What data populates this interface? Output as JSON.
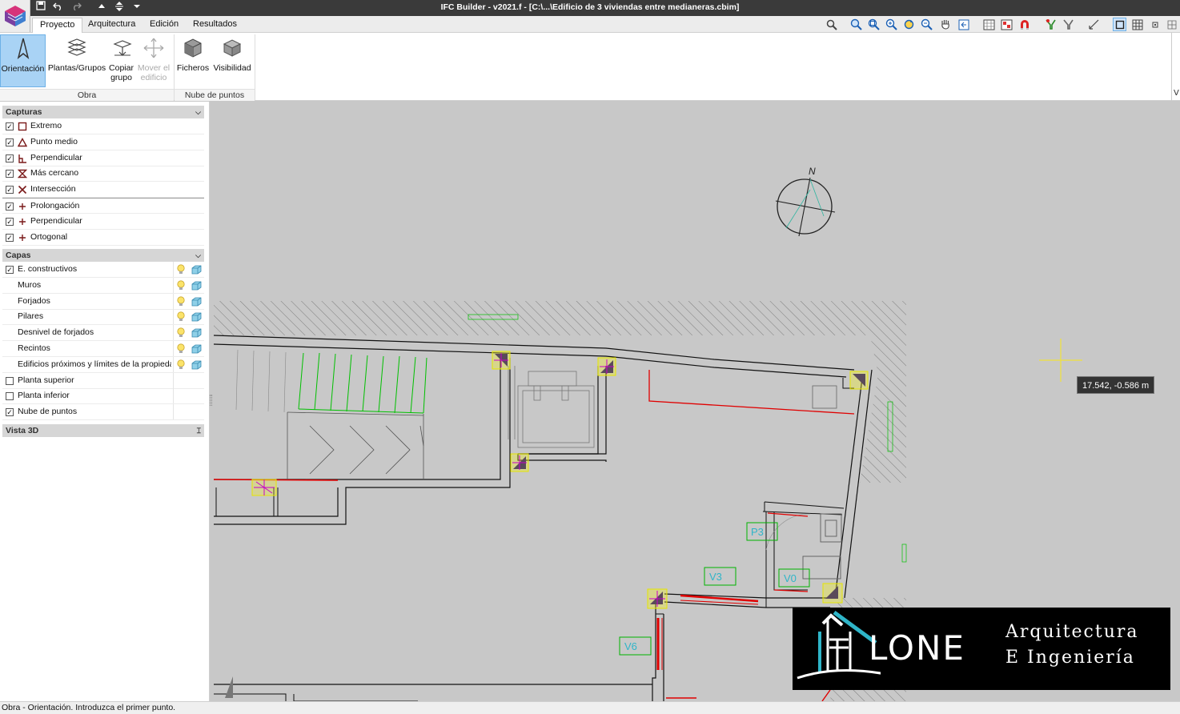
{
  "window": {
    "title": "IFC Builder - v2021.f - [C:\\...\\Edificio de 3 viviendas entre medianeras.cbim]"
  },
  "tabs": [
    {
      "label": "Proyecto",
      "active": true
    },
    {
      "label": "Arquitectura",
      "active": false
    },
    {
      "label": "Edición",
      "active": false
    },
    {
      "label": "Resultados",
      "active": false
    }
  ],
  "ribbon": {
    "buttons": [
      {
        "label": "Orientación",
        "active": true,
        "disabled": false
      },
      {
        "label": "Plantas/Grupos",
        "active": false,
        "disabled": false
      },
      {
        "label": "Copiar grupo",
        "active": false,
        "disabled": false
      },
      {
        "label": "Mover el edificio",
        "active": false,
        "disabled": true
      },
      {
        "label": "Ficheros",
        "active": false,
        "disabled": false
      },
      {
        "label": "Visibilidad",
        "active": false,
        "disabled": false
      }
    ],
    "groups": [
      {
        "label": "Obra"
      },
      {
        "label": "Nube de puntos"
      }
    ],
    "right_edge_label": "V"
  },
  "panel": {
    "capturas": {
      "title": "Capturas",
      "items": [
        {
          "label": "Extremo",
          "checked": true,
          "icon": "square-snap-icon"
        },
        {
          "label": "Punto medio",
          "checked": true,
          "icon": "triangle-snap-icon"
        },
        {
          "label": "Perpendicular",
          "checked": true,
          "icon": "perpendicular-snap-icon"
        },
        {
          "label": "Más cercano",
          "checked": true,
          "icon": "hourglass-snap-icon"
        },
        {
          "label": "Intersección",
          "checked": true,
          "icon": "cross-snap-icon"
        },
        {
          "label": "Prolongación",
          "checked": true,
          "icon": "plus-icon"
        },
        {
          "label": "Perpendicular",
          "checked": true,
          "icon": "plus-icon"
        },
        {
          "label": "Ortogonal",
          "checked": true,
          "icon": "plus-icon"
        }
      ]
    },
    "capas": {
      "title": "Capas",
      "items": [
        {
          "label": "E. constructivos",
          "checkbox": true,
          "checked": true,
          "indent": false,
          "tools": true
        },
        {
          "label": "Muros",
          "checkbox": false,
          "checked": false,
          "indent": true,
          "tools": true
        },
        {
          "label": "Forjados",
          "checkbox": false,
          "checked": false,
          "indent": true,
          "tools": true
        },
        {
          "label": "Pilares",
          "checkbox": false,
          "checked": false,
          "indent": true,
          "tools": true
        },
        {
          "label": "Desnivel de forjados",
          "checkbox": false,
          "checked": false,
          "indent": true,
          "tools": true
        },
        {
          "label": "Recintos",
          "checkbox": false,
          "checked": false,
          "indent": true,
          "tools": true
        },
        {
          "label": "Edificios próximos y límites de la propiedad",
          "checkbox": false,
          "checked": false,
          "indent": true,
          "tools": true
        },
        {
          "label": "Planta superior",
          "checkbox": true,
          "checked": false,
          "indent": false,
          "tools": false
        },
        {
          "label": "Planta inferior",
          "checkbox": true,
          "checked": false,
          "indent": false,
          "tools": false
        },
        {
          "label": "Nube de puntos",
          "checkbox": true,
          "checked": true,
          "indent": false,
          "tools": false
        }
      ]
    },
    "vista3d": {
      "title": "Vista 3D"
    }
  },
  "canvas": {
    "compass_label": "N",
    "coordinate_readout": "17.542, -0.586 m",
    "tags": [
      "P3",
      "V3",
      "V0",
      "V6"
    ]
  },
  "brand": {
    "word": "LONE",
    "line1": "Arquitectura",
    "line2": "E Ingeniería"
  },
  "status": {
    "text": "Obra - Orientación. Introduzca el primer punto."
  },
  "colors": {
    "accent": "#a9d3f5",
    "titlebar": "#3a3a3a",
    "canvas": "#c8c8c8",
    "tag_green": "#00b400",
    "wall_red": "#e00000"
  }
}
